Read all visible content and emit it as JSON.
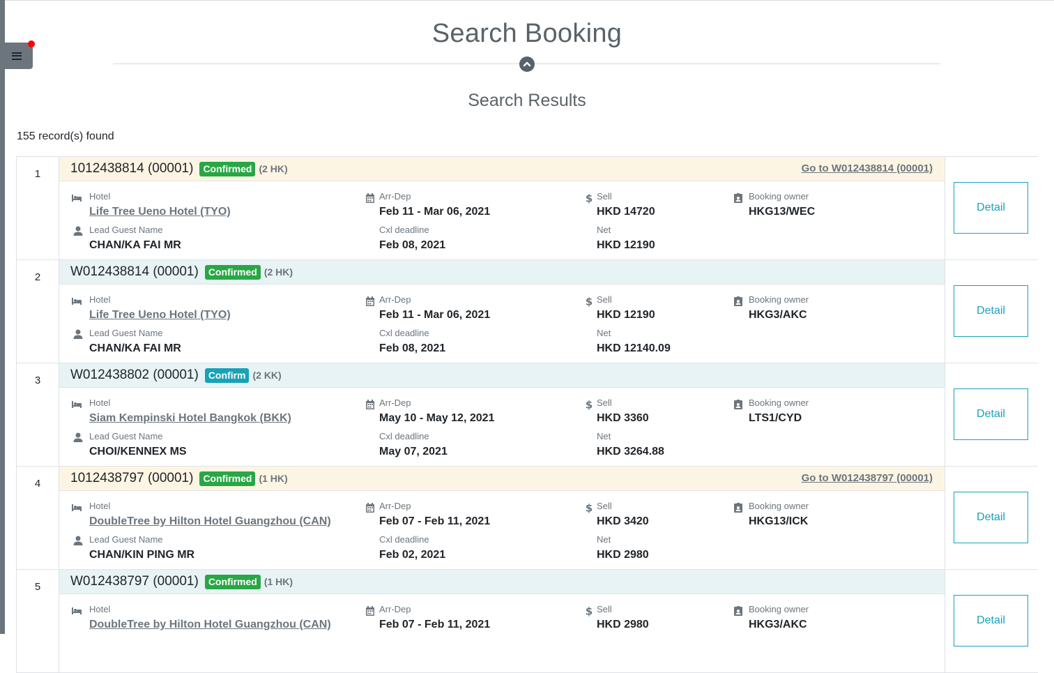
{
  "header": {
    "title": "Search Booking",
    "results_title": "Search Results",
    "record_count": "155 record(s) found"
  },
  "labels": {
    "hotel": "Hotel",
    "arr_dep": "Arr-Dep",
    "sell": "Sell",
    "booking_owner": "Booking owner",
    "lead_guest": "Lead Guest Name",
    "cxl_deadline": "Cxl deadline",
    "net": "Net",
    "detail": "Detail"
  },
  "colors": {
    "confirmed": "#28a745",
    "confirm": "#17a2b8",
    "internal_header": "#fdf5e4",
    "external_header": "#e8f3f5",
    "accent": "#17a2b8"
  },
  "icons": {
    "menu": "bars-icon",
    "collapse": "chevron-up-icon",
    "hotel": "bed-icon",
    "guest": "user-icon",
    "date": "calendar-icon",
    "money": "dollar-icon",
    "owner": "id-badge-icon"
  },
  "bookings": [
    {
      "num": "1",
      "ref": "1012438814 (00001)",
      "status": "Confirmed",
      "status_color": "green",
      "units": "(2 HK)",
      "header_type": "internal",
      "goto": "Go to W012438814 (00001)",
      "hotel": "Life Tree Ueno Hotel (TYO)",
      "dates": "Feb 11 - Mar 06, 2021",
      "sell": "HKD 14720",
      "owner": "HKG13/WEC",
      "guest": "CHAN/KA FAI MR",
      "cxl": "Feb 08, 2021",
      "net": "HKD 12190"
    },
    {
      "num": "2",
      "ref": "W012438814 (00001)",
      "status": "Confirmed",
      "status_color": "green",
      "units": "(2 HK)",
      "header_type": "external",
      "goto": "",
      "hotel": "Life Tree Ueno Hotel (TYO)",
      "dates": "Feb 11 - Mar 06, 2021",
      "sell": "HKD 12190",
      "owner": "HKG3/AKC",
      "guest": "CHAN/KA FAI MR",
      "cxl": "Feb 08, 2021",
      "net": "HKD 12140.09"
    },
    {
      "num": "3",
      "ref": "W012438802 (00001)",
      "status": "Confirm",
      "status_color": "teal",
      "units": "(2 KK)",
      "header_type": "external",
      "goto": "",
      "hotel": "Siam Kempinski Hotel Bangkok (BKK)",
      "dates": "May 10 - May 12, 2021",
      "sell": "HKD 3360",
      "owner": "LTS1/CYD",
      "guest": "CHOI/KENNEX MS",
      "cxl": "May 07, 2021",
      "net": "HKD 3264.88"
    },
    {
      "num": "4",
      "ref": "1012438797 (00001)",
      "status": "Confirmed",
      "status_color": "green",
      "units": "(1 HK)",
      "header_type": "internal",
      "goto": "Go to W012438797 (00001)",
      "hotel": "DoubleTree by Hilton Hotel Guangzhou (CAN)",
      "dates": "Feb 07 - Feb 11, 2021",
      "sell": "HKD 3420",
      "owner": "HKG13/ICK",
      "guest": "CHAN/KIN PING MR",
      "cxl": "Feb 02, 2021",
      "net": "HKD 2980"
    },
    {
      "num": "5",
      "ref": "W012438797 (00001)",
      "status": "Confirmed",
      "status_color": "green",
      "units": "(1 HK)",
      "header_type": "external",
      "goto": "",
      "hotel": "DoubleTree by Hilton Hotel Guangzhou (CAN)",
      "dates": "Feb 07 - Feb 11, 2021",
      "sell": "HKD 2980",
      "owner": "HKG3/AKC",
      "guest": "",
      "cxl": "",
      "net": ""
    }
  ]
}
